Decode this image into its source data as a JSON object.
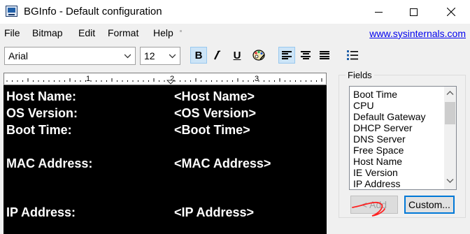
{
  "window": {
    "title": "BGInfo - Default configuration"
  },
  "menu": {
    "items": [
      "File",
      "Bitmap",
      "Edit",
      "Format",
      "Help"
    ],
    "link": "www.sysinternals.com"
  },
  "toolbar": {
    "font": "Arial",
    "size": "12",
    "bold": "B",
    "italic": "I",
    "underline": "U"
  },
  "ruler": {
    "marks": [
      "1",
      "2",
      "3"
    ]
  },
  "editor": {
    "lines": [
      {
        "label": "Host Name:",
        "value": "<Host Name>"
      },
      {
        "label": "OS Version:",
        "value": "<OS Version>"
      },
      {
        "label": "Boot Time:",
        "value": "<Boot Time>"
      },
      {
        "label": "MAC Address:",
        "value": "<MAC Address>"
      },
      {
        "label": "IP Address:",
        "value": "<IP Address>"
      }
    ]
  },
  "fields": {
    "title": "Fields",
    "items": [
      "Boot Time",
      "CPU",
      "Default Gateway",
      "DHCP Server",
      "DNS Server",
      "Free Space",
      "Host Name",
      "IE Version",
      "IP Address"
    ],
    "add_label": "< Add",
    "custom_label": "Custom..."
  },
  "colors": {
    "accent": "#0078d7",
    "link": "#0000ee",
    "editor_bg": "#000000",
    "annotation": "#ff0000"
  }
}
